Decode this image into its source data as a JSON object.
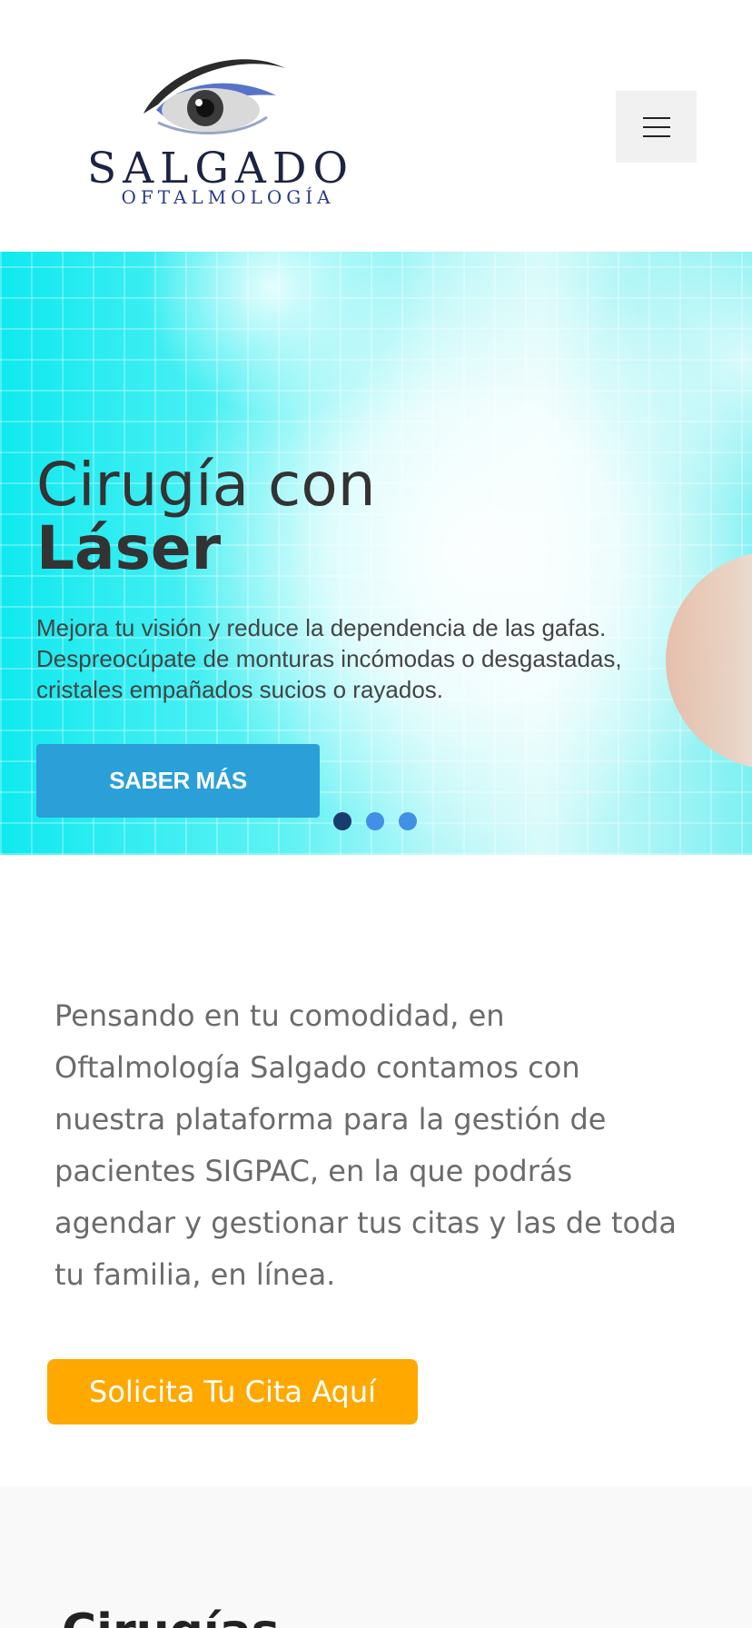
{
  "brand": {
    "name": "SALGADO",
    "subtitle": "OFTALMOLOGÍA"
  },
  "header": {
    "menu_icon": "hamburger-menu-icon"
  },
  "hero": {
    "title_line1": "Cirugía con",
    "title_line2": "Láser",
    "text": "Mejora tu visión y reduce la dependencia de las gafas. Despreocúpate de monturas incómodas o desgastadas, cristales empañados sucios o rayados.",
    "button_label": "SABER MÁS",
    "slides_total": 3,
    "active_slide": 1,
    "colors": {
      "button": "#2a9fd8",
      "dot_active": "#1a3b6e",
      "dot": "#3f90e6"
    }
  },
  "info": {
    "text": "Pensando en tu comodidad, en Oftalmología Salgado contamos con nuestra plataforma para la gestión de pacientes SIGPAC, en la que podrás agendar y gestionar tus citas y las de toda tu familia, en línea.",
    "cta_label": "Solicita Tu Cita Aquí",
    "colors": {
      "cta": "#ffa800"
    }
  },
  "next_section": {
    "title": "Cirugías"
  }
}
